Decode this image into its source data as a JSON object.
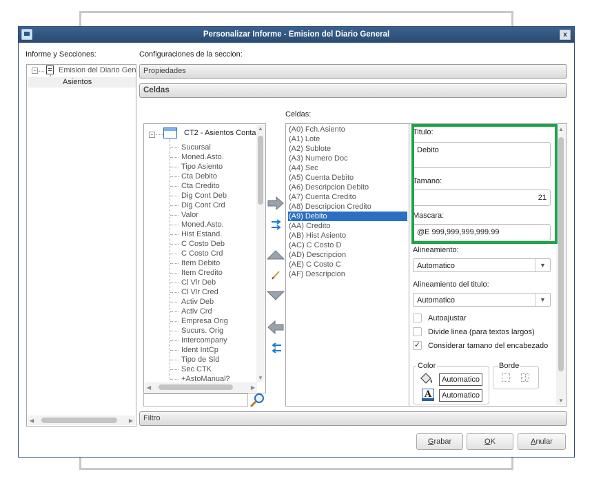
{
  "window": {
    "title": "Personalizar Informe - Emision del Diario General",
    "close_glyph": "x"
  },
  "left": {
    "heading": "Informe y Secciones:",
    "tree": {
      "root": "Emision del Diario Gene",
      "child": "Asientos",
      "expand_glyph": "-"
    }
  },
  "config": {
    "heading": "Configuraciones de la seccion:",
    "propiedades": "Propiedades",
    "celdas_bar": "Celdas",
    "celdas_label": "Celdas:",
    "filtro": "Filtro"
  },
  "fields": {
    "table_name": "CT2 - Asientos Conta",
    "items": [
      "Sucursal",
      "Moned.Asto.",
      "Tipo Asiento",
      "Cta Debito",
      "Cta Credito",
      "Dig Cont Deb",
      "Dig Cont Crd",
      "Valor",
      "Moned.Asto.",
      "Hist Estand.",
      "C Costo Deb",
      "C Costo Crd",
      "Item Debito",
      "Item Credito",
      "Cl Vlr Deb",
      "Cl Vlr Cred",
      "Activ Deb",
      "Activ Crd",
      "Empresa Orig",
      "Sucurs. Orig",
      "Intercompany",
      "Ident IntCp",
      "Tipo de Sld",
      "Sec CTK",
      "+AstoManual?"
    ]
  },
  "cells": {
    "items": [
      "(A0) Fch.Asiento",
      "(A1) Lote",
      "(A2) Sublote",
      "(A3) Numero Doc",
      "(A4) Sec",
      "(A5) Cuenta Debito",
      "(A6) Descripcion Debito",
      "(A7) Cuenta Credito",
      "(A8) Descripcion Credito",
      "(A9) Debito",
      "(AA) Credito",
      "(AB) Hist Asiento",
      "(AC) C Costo D",
      "(AD) Descripcion",
      "(AE) C Costo C",
      "(AF) Descripcion"
    ],
    "selected_index": 9
  },
  "props": {
    "titulo_label": "Titulo:",
    "titulo_value": "Debito",
    "tamano_label": "Tamano:",
    "tamano_value": "21",
    "mascara_label": "Mascara:",
    "mascara_value": "@E 999,999,999,999.99",
    "alineamiento_label": "Alineamiento:",
    "alineamiento_value": "Automatico",
    "alineamiento_titulo_label": "Alineamiento del titulo:",
    "alineamiento_titulo_value": "Automatico",
    "autoajustar": "Autoajustar",
    "divide_linea": "Divide linea (para textos largos)",
    "considerar": "Considerar tamano del encabezado",
    "autoajustar_checked": false,
    "divide_linea_checked": false,
    "considerar_checked": true,
    "color_label": "Color",
    "fill_color": "Automatico",
    "text_color": "Automatico",
    "borde_label": "Borde",
    "dropdown_glyph": "▼",
    "check_glyph": "✓"
  },
  "buttons": {
    "grabar_hotkey": "G",
    "grabar_rest": "rabar",
    "ok_hotkey": "O",
    "ok_rest": "K",
    "anular_hotkey": "A",
    "anular_rest": "nular"
  },
  "colors": {
    "titlebar": "#2f5580",
    "selection": "#2b6fc2",
    "highlight": "#1fa24a"
  }
}
